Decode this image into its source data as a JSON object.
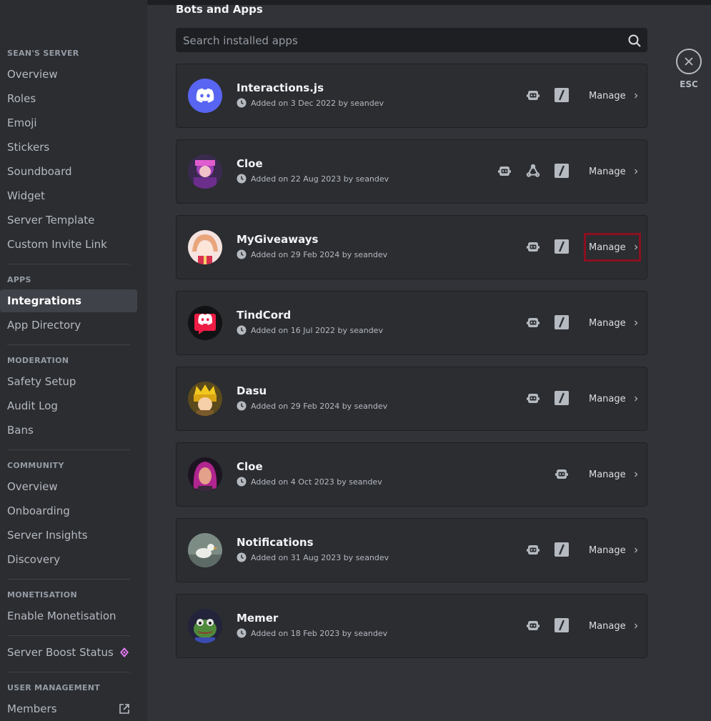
{
  "window": {
    "esc_label": "ESC"
  },
  "sidebar": {
    "sections": [
      {
        "header": "SEAN'S SERVER",
        "items": [
          "Overview",
          "Roles",
          "Emoji",
          "Stickers",
          "Soundboard",
          "Widget",
          "Server Template",
          "Custom Invite Link"
        ]
      },
      {
        "header": "APPS",
        "items": [
          "Integrations",
          "App Directory"
        ]
      },
      {
        "header": "MODERATION",
        "items": [
          "Safety Setup",
          "Audit Log",
          "Bans"
        ]
      },
      {
        "header": "COMMUNITY",
        "items": [
          "Overview",
          "Onboarding",
          "Server Insights",
          "Discovery"
        ]
      },
      {
        "header": "MONETISATION",
        "items": [
          "Enable Monetisation"
        ]
      },
      {
        "header": "",
        "items": [
          "Server Boost Status"
        ]
      },
      {
        "header": "USER MANAGEMENT",
        "items": [
          "Members"
        ]
      }
    ],
    "active_item": "Integrations",
    "boost_icon_color": "#e879f9"
  },
  "main": {
    "title": "Bots and Apps",
    "search_placeholder": "Search installed apps",
    "manage_label": "Manage",
    "apps": [
      {
        "name": "Interactions.js",
        "added": "Added on 3 Dec 2022 by seandev",
        "avatar": "discord-blue-icon",
        "perms": [
          "bot-icon",
          "slash-command-icon"
        ]
      },
      {
        "name": "Cloe",
        "added": "Added on 22 Aug 2023 by seandev",
        "avatar": "purple-character-icon",
        "perms": [
          "bot-icon",
          "webhook-icon",
          "slash-command-icon"
        ]
      },
      {
        "name": "MyGiveaways",
        "added": "Added on 29 Feb 2024 by seandev",
        "avatar": "anime-girl-icon",
        "perms": [
          "bot-icon",
          "slash-command-icon"
        ],
        "highlighted": true
      },
      {
        "name": "TindCord",
        "added": "Added on 16 Jul 2022 by seandev",
        "avatar": "discord-red-icon",
        "perms": [
          "bot-icon",
          "slash-command-icon"
        ]
      },
      {
        "name": "Dasu",
        "added": "Added on 29 Feb 2024 by seandev",
        "avatar": "crowned-character-icon",
        "perms": [
          "bot-icon",
          "slash-command-icon"
        ]
      },
      {
        "name": "Cloe",
        "added": "Added on 4 Oct 2023 by seandev",
        "avatar": "pink-hair-character-icon",
        "perms": [
          "bot-icon"
        ]
      },
      {
        "name": "Notifications",
        "added": "Added on 31 Aug 2023 by seandev",
        "avatar": "duck-photo-icon",
        "perms": [
          "bot-icon",
          "slash-command-icon"
        ]
      },
      {
        "name": "Memer",
        "added": "Added on 18 Feb 2023 by seandev",
        "avatar": "frog-icon",
        "perms": [
          "bot-icon",
          "slash-command-icon"
        ]
      }
    ]
  },
  "colors": {
    "highlight": "#8b1021",
    "discord_blue": "#5865f2",
    "discord_red": "#ed1c45"
  }
}
